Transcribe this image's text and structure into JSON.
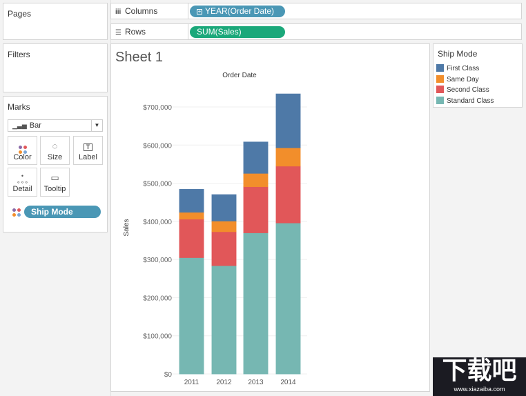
{
  "pages": {
    "title": "Pages"
  },
  "filters": {
    "title": "Filters"
  },
  "marks": {
    "title": "Marks",
    "mark_type": "Bar",
    "buttons": [
      {
        "label": "Color",
        "icon": "color-dots-icon"
      },
      {
        "label": "Size",
        "icon": "size-circles-icon"
      },
      {
        "label": "Label",
        "icon": "label-text-icon"
      },
      {
        "label": "Detail",
        "icon": "detail-dots-icon"
      },
      {
        "label": "Tooltip",
        "icon": "tooltip-bubble-icon"
      }
    ],
    "color_field": "Ship Mode"
  },
  "shelves": {
    "columns": {
      "label": "Columns",
      "pill": "YEAR(Order Date)"
    },
    "rows": {
      "label": "Rows",
      "pill": "SUM(Sales)"
    }
  },
  "sheet": {
    "title": "Sheet 1"
  },
  "legend": {
    "title": "Ship Mode",
    "items": [
      {
        "label": "First Class",
        "color": "#4e79a7"
      },
      {
        "label": "Same Day",
        "color": "#f28e2b"
      },
      {
        "label": "Second Class",
        "color": "#e15759"
      },
      {
        "label": "Standard Class",
        "color": "#76b7b2"
      }
    ]
  },
  "watermark": {
    "text": "下载吧",
    "url": "www.xiazaiba.com"
  },
  "chart_data": {
    "type": "bar",
    "stacked": true,
    "title": "Order Date",
    "xlabel": "",
    "ylabel": "Sales",
    "categories": [
      "2011",
      "2012",
      "2013",
      "2014"
    ],
    "series": [
      {
        "name": "Standard Class",
        "color": "#76b7b2",
        "values": [
          305000,
          284000,
          370000,
          396000
        ]
      },
      {
        "name": "Second Class",
        "color": "#e15759",
        "values": [
          101000,
          89000,
          121000,
          149000
        ]
      },
      {
        "name": "Same Day",
        "color": "#f28e2b",
        "values": [
          18000,
          28000,
          35000,
          48000
        ]
      },
      {
        "name": "First Class",
        "color": "#4e79a7",
        "values": [
          60000,
          69000,
          82000,
          141000
        ]
      }
    ],
    "ylim": [
      0,
      700000
    ],
    "yticks": [
      0,
      100000,
      200000,
      300000,
      400000,
      500000,
      600000,
      700000
    ],
    "ytick_labels": [
      "$0",
      "$100,000",
      "$200,000",
      "$300,000",
      "$400,000",
      "$500,000",
      "$600,000",
      "$700,000"
    ],
    "grid": true,
    "legend_position": "right"
  }
}
